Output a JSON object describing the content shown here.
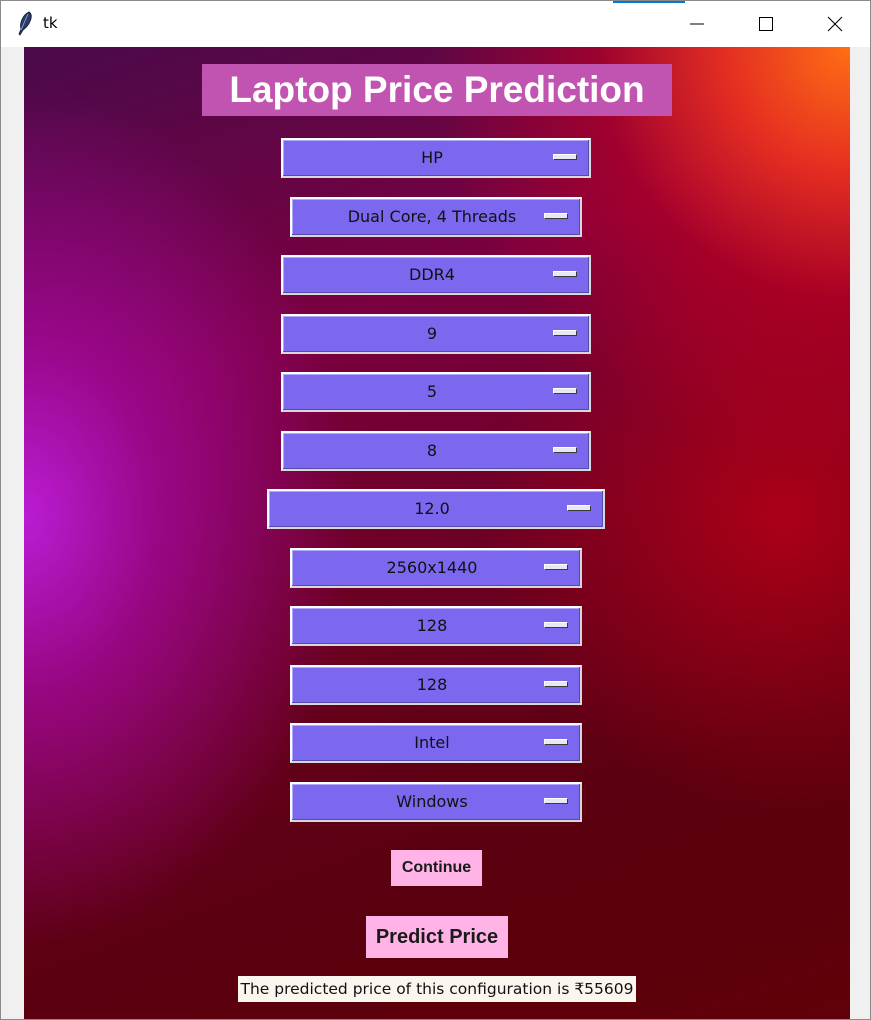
{
  "window": {
    "title": "tk",
    "controls": {
      "minimize_icon": "minimize-icon",
      "maximize_icon": "maximize-icon",
      "close_icon": "close-icon"
    }
  },
  "app": {
    "heading": "Laptop Price Prediction",
    "dropdowns": [
      {
        "value": "HP"
      },
      {
        "value": "Dual Core, 4 Threads"
      },
      {
        "value": "DDR4"
      },
      {
        "value": "9"
      },
      {
        "value": "5"
      },
      {
        "value": "8"
      },
      {
        "value": "12.0"
      },
      {
        "value": "2560x1440"
      },
      {
        "value": "128"
      },
      {
        "value": "128"
      },
      {
        "value": "Intel"
      },
      {
        "value": "Windows"
      }
    ],
    "continue_label": "Continue",
    "predict_label": "Predict Price",
    "result_text": "The predicted price of this configuration is ₹55609"
  },
  "colors": {
    "heading_bg": "#c054b0",
    "dropdown_bg": "#7b68ee",
    "button_bg": "#ffb3e6",
    "result_bg": "#fcf7ee",
    "titlebar_accent": "#0078d7"
  }
}
